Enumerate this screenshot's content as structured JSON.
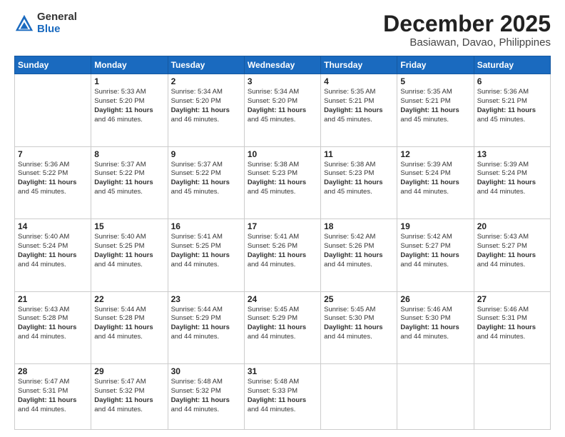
{
  "logo": {
    "general": "General",
    "blue": "Blue"
  },
  "title": "December 2025",
  "subtitle": "Basiawan, Davao, Philippines",
  "days_of_week": [
    "Sunday",
    "Monday",
    "Tuesday",
    "Wednesday",
    "Thursday",
    "Friday",
    "Saturday"
  ],
  "weeks": [
    [
      {
        "day": "",
        "info": ""
      },
      {
        "day": "1",
        "info": "Sunrise: 5:33 AM\nSunset: 5:20 PM\nDaylight: 11 hours\nand 46 minutes."
      },
      {
        "day": "2",
        "info": "Sunrise: 5:34 AM\nSunset: 5:20 PM\nDaylight: 11 hours\nand 46 minutes."
      },
      {
        "day": "3",
        "info": "Sunrise: 5:34 AM\nSunset: 5:20 PM\nDaylight: 11 hours\nand 45 minutes."
      },
      {
        "day": "4",
        "info": "Sunrise: 5:35 AM\nSunset: 5:21 PM\nDaylight: 11 hours\nand 45 minutes."
      },
      {
        "day": "5",
        "info": "Sunrise: 5:35 AM\nSunset: 5:21 PM\nDaylight: 11 hours\nand 45 minutes."
      },
      {
        "day": "6",
        "info": "Sunrise: 5:36 AM\nSunset: 5:21 PM\nDaylight: 11 hours\nand 45 minutes."
      }
    ],
    [
      {
        "day": "7",
        "info": "Sunrise: 5:36 AM\nSunset: 5:22 PM\nDaylight: 11 hours\nand 45 minutes."
      },
      {
        "day": "8",
        "info": "Sunrise: 5:37 AM\nSunset: 5:22 PM\nDaylight: 11 hours\nand 45 minutes."
      },
      {
        "day": "9",
        "info": "Sunrise: 5:37 AM\nSunset: 5:22 PM\nDaylight: 11 hours\nand 45 minutes."
      },
      {
        "day": "10",
        "info": "Sunrise: 5:38 AM\nSunset: 5:23 PM\nDaylight: 11 hours\nand 45 minutes."
      },
      {
        "day": "11",
        "info": "Sunrise: 5:38 AM\nSunset: 5:23 PM\nDaylight: 11 hours\nand 45 minutes."
      },
      {
        "day": "12",
        "info": "Sunrise: 5:39 AM\nSunset: 5:24 PM\nDaylight: 11 hours\nand 44 minutes."
      },
      {
        "day": "13",
        "info": "Sunrise: 5:39 AM\nSunset: 5:24 PM\nDaylight: 11 hours\nand 44 minutes."
      }
    ],
    [
      {
        "day": "14",
        "info": "Sunrise: 5:40 AM\nSunset: 5:24 PM\nDaylight: 11 hours\nand 44 minutes."
      },
      {
        "day": "15",
        "info": "Sunrise: 5:40 AM\nSunset: 5:25 PM\nDaylight: 11 hours\nand 44 minutes."
      },
      {
        "day": "16",
        "info": "Sunrise: 5:41 AM\nSunset: 5:25 PM\nDaylight: 11 hours\nand 44 minutes."
      },
      {
        "day": "17",
        "info": "Sunrise: 5:41 AM\nSunset: 5:26 PM\nDaylight: 11 hours\nand 44 minutes."
      },
      {
        "day": "18",
        "info": "Sunrise: 5:42 AM\nSunset: 5:26 PM\nDaylight: 11 hours\nand 44 minutes."
      },
      {
        "day": "19",
        "info": "Sunrise: 5:42 AM\nSunset: 5:27 PM\nDaylight: 11 hours\nand 44 minutes."
      },
      {
        "day": "20",
        "info": "Sunrise: 5:43 AM\nSunset: 5:27 PM\nDaylight: 11 hours\nand 44 minutes."
      }
    ],
    [
      {
        "day": "21",
        "info": "Sunrise: 5:43 AM\nSunset: 5:28 PM\nDaylight: 11 hours\nand 44 minutes."
      },
      {
        "day": "22",
        "info": "Sunrise: 5:44 AM\nSunset: 5:28 PM\nDaylight: 11 hours\nand 44 minutes."
      },
      {
        "day": "23",
        "info": "Sunrise: 5:44 AM\nSunset: 5:29 PM\nDaylight: 11 hours\nand 44 minutes."
      },
      {
        "day": "24",
        "info": "Sunrise: 5:45 AM\nSunset: 5:29 PM\nDaylight: 11 hours\nand 44 minutes."
      },
      {
        "day": "25",
        "info": "Sunrise: 5:45 AM\nSunset: 5:30 PM\nDaylight: 11 hours\nand 44 minutes."
      },
      {
        "day": "26",
        "info": "Sunrise: 5:46 AM\nSunset: 5:30 PM\nDaylight: 11 hours\nand 44 minutes."
      },
      {
        "day": "27",
        "info": "Sunrise: 5:46 AM\nSunset: 5:31 PM\nDaylight: 11 hours\nand 44 minutes."
      }
    ],
    [
      {
        "day": "28",
        "info": "Sunrise: 5:47 AM\nSunset: 5:31 PM\nDaylight: 11 hours\nand 44 minutes."
      },
      {
        "day": "29",
        "info": "Sunrise: 5:47 AM\nSunset: 5:32 PM\nDaylight: 11 hours\nand 44 minutes."
      },
      {
        "day": "30",
        "info": "Sunrise: 5:48 AM\nSunset: 5:32 PM\nDaylight: 11 hours\nand 44 minutes."
      },
      {
        "day": "31",
        "info": "Sunrise: 5:48 AM\nSunset: 5:33 PM\nDaylight: 11 hours\nand 44 minutes."
      },
      {
        "day": "",
        "info": ""
      },
      {
        "day": "",
        "info": ""
      },
      {
        "day": "",
        "info": ""
      }
    ]
  ]
}
